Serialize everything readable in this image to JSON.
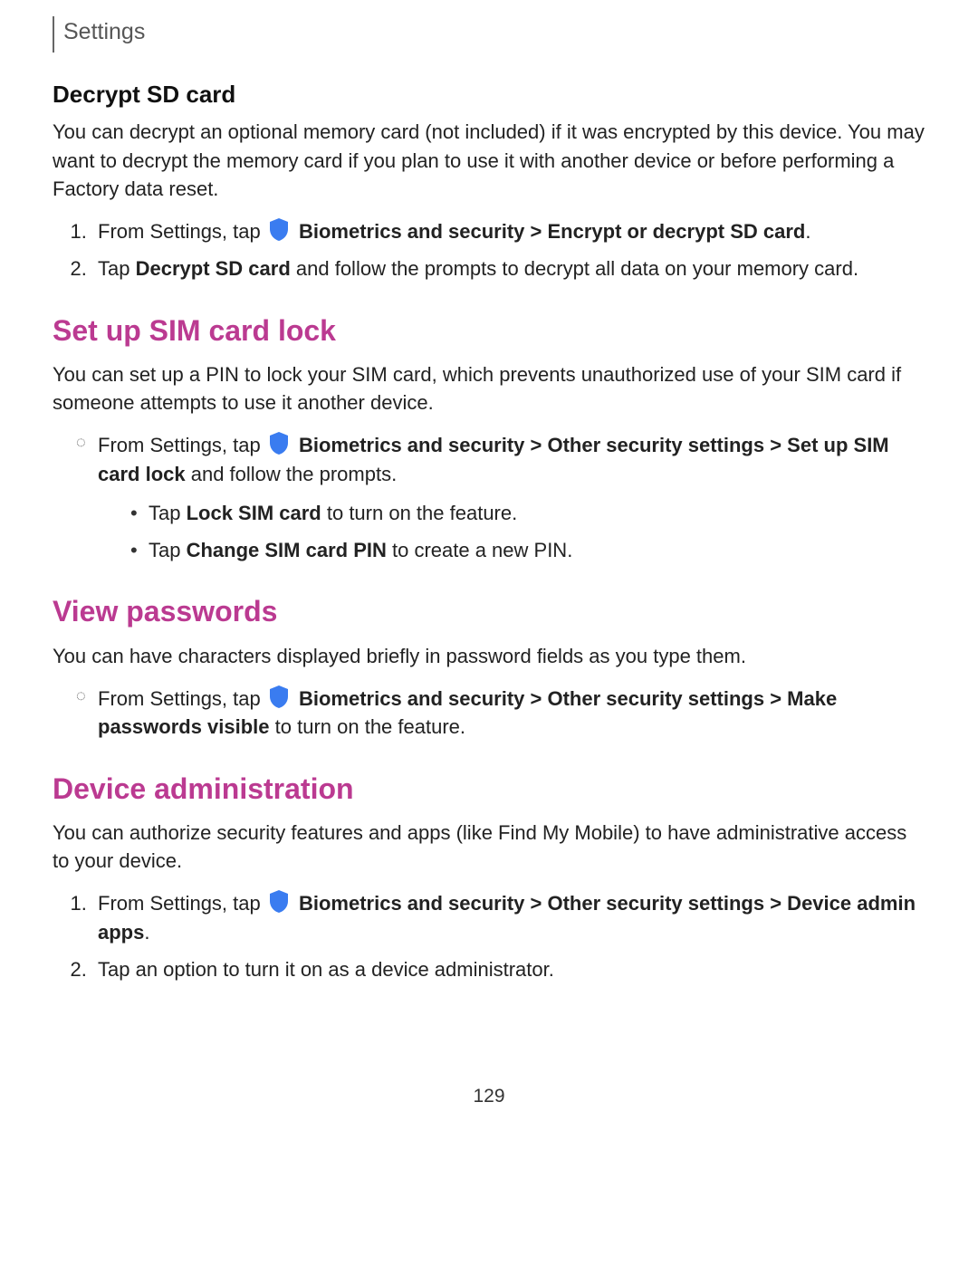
{
  "header": {
    "title": "Settings"
  },
  "decrypt": {
    "heading": "Decrypt SD card",
    "intro": "You can decrypt an optional memory card (not included) if it was encrypted by this device. You may want to decrypt the memory card if you plan to use it with another device or before performing a Factory data reset.",
    "steps": {
      "s1": {
        "prefix": "From Settings, tap ",
        "bold": "Biometrics and security > Encrypt or decrypt SD card",
        "suffix": "."
      },
      "s2": {
        "prefix": "Tap ",
        "bold": "Decrypt SD card",
        "suffix": " and follow the prompts to decrypt all data on your memory card."
      }
    }
  },
  "simlock": {
    "heading": "Set up SIM card lock",
    "intro": "You can set up a PIN to lock your SIM card, which prevents unauthorized use of your SIM card if someone attempts to use it another device.",
    "step": {
      "prefix": "From Settings, tap ",
      "bold1": "Biometrics and security > Other security settings > Set up SIM card lock",
      "suffix": " and follow the prompts."
    },
    "sub": {
      "a": {
        "prefix": "Tap ",
        "bold": "Lock SIM card",
        "suffix": " to turn on the feature."
      },
      "b": {
        "prefix": "Tap ",
        "bold": "Change SIM card PIN",
        "suffix": " to create a new PIN."
      }
    }
  },
  "viewpw": {
    "heading": "View passwords",
    "intro": "You can have characters displayed briefly in password fields as you type them.",
    "step": {
      "prefix": "From Settings, tap ",
      "bold1": "Biometrics and security > Other security settings > Make passwords visible",
      "suffix": " to turn on the feature."
    }
  },
  "devadmin": {
    "heading": "Device administration",
    "intro": "You can authorize security features and apps (like Find My Mobile) to have administrative access to your device.",
    "steps": {
      "s1": {
        "prefix": "From Settings, tap ",
        "bold": "Biometrics and security > Other security settings > Device admin apps",
        "suffix": "."
      },
      "s2": {
        "text": "Tap an option to turn it on as a device administrator."
      }
    }
  },
  "page_number": "129"
}
